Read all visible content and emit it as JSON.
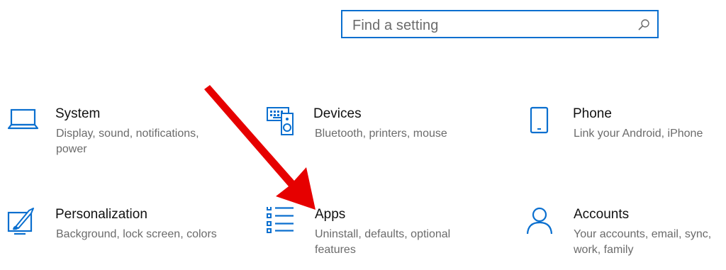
{
  "search": {
    "placeholder": "Find a setting",
    "icon": "search-icon"
  },
  "tiles": [
    {
      "title": "System",
      "desc": "Display, sound, notifications, power",
      "icon": "laptop-icon"
    },
    {
      "title": "Devices",
      "desc": "Bluetooth, printers, mouse",
      "icon": "keyboard-speaker-icon"
    },
    {
      "title": "Phone",
      "desc": "Link your Android, iPhone",
      "icon": "phone-icon"
    },
    {
      "title": "Personalization",
      "desc": "Background, lock screen, colors",
      "icon": "paintbrush-monitor-icon"
    },
    {
      "title": "Apps",
      "desc": "Uninstall, defaults, optional features",
      "icon": "apps-list-icon"
    },
    {
      "title": "Accounts",
      "desc": "Your accounts, email, sync, work, family",
      "icon": "person-icon"
    }
  ],
  "colors": {
    "accent": "#0a6fcf",
    "annotation_arrow": "#e60000"
  }
}
